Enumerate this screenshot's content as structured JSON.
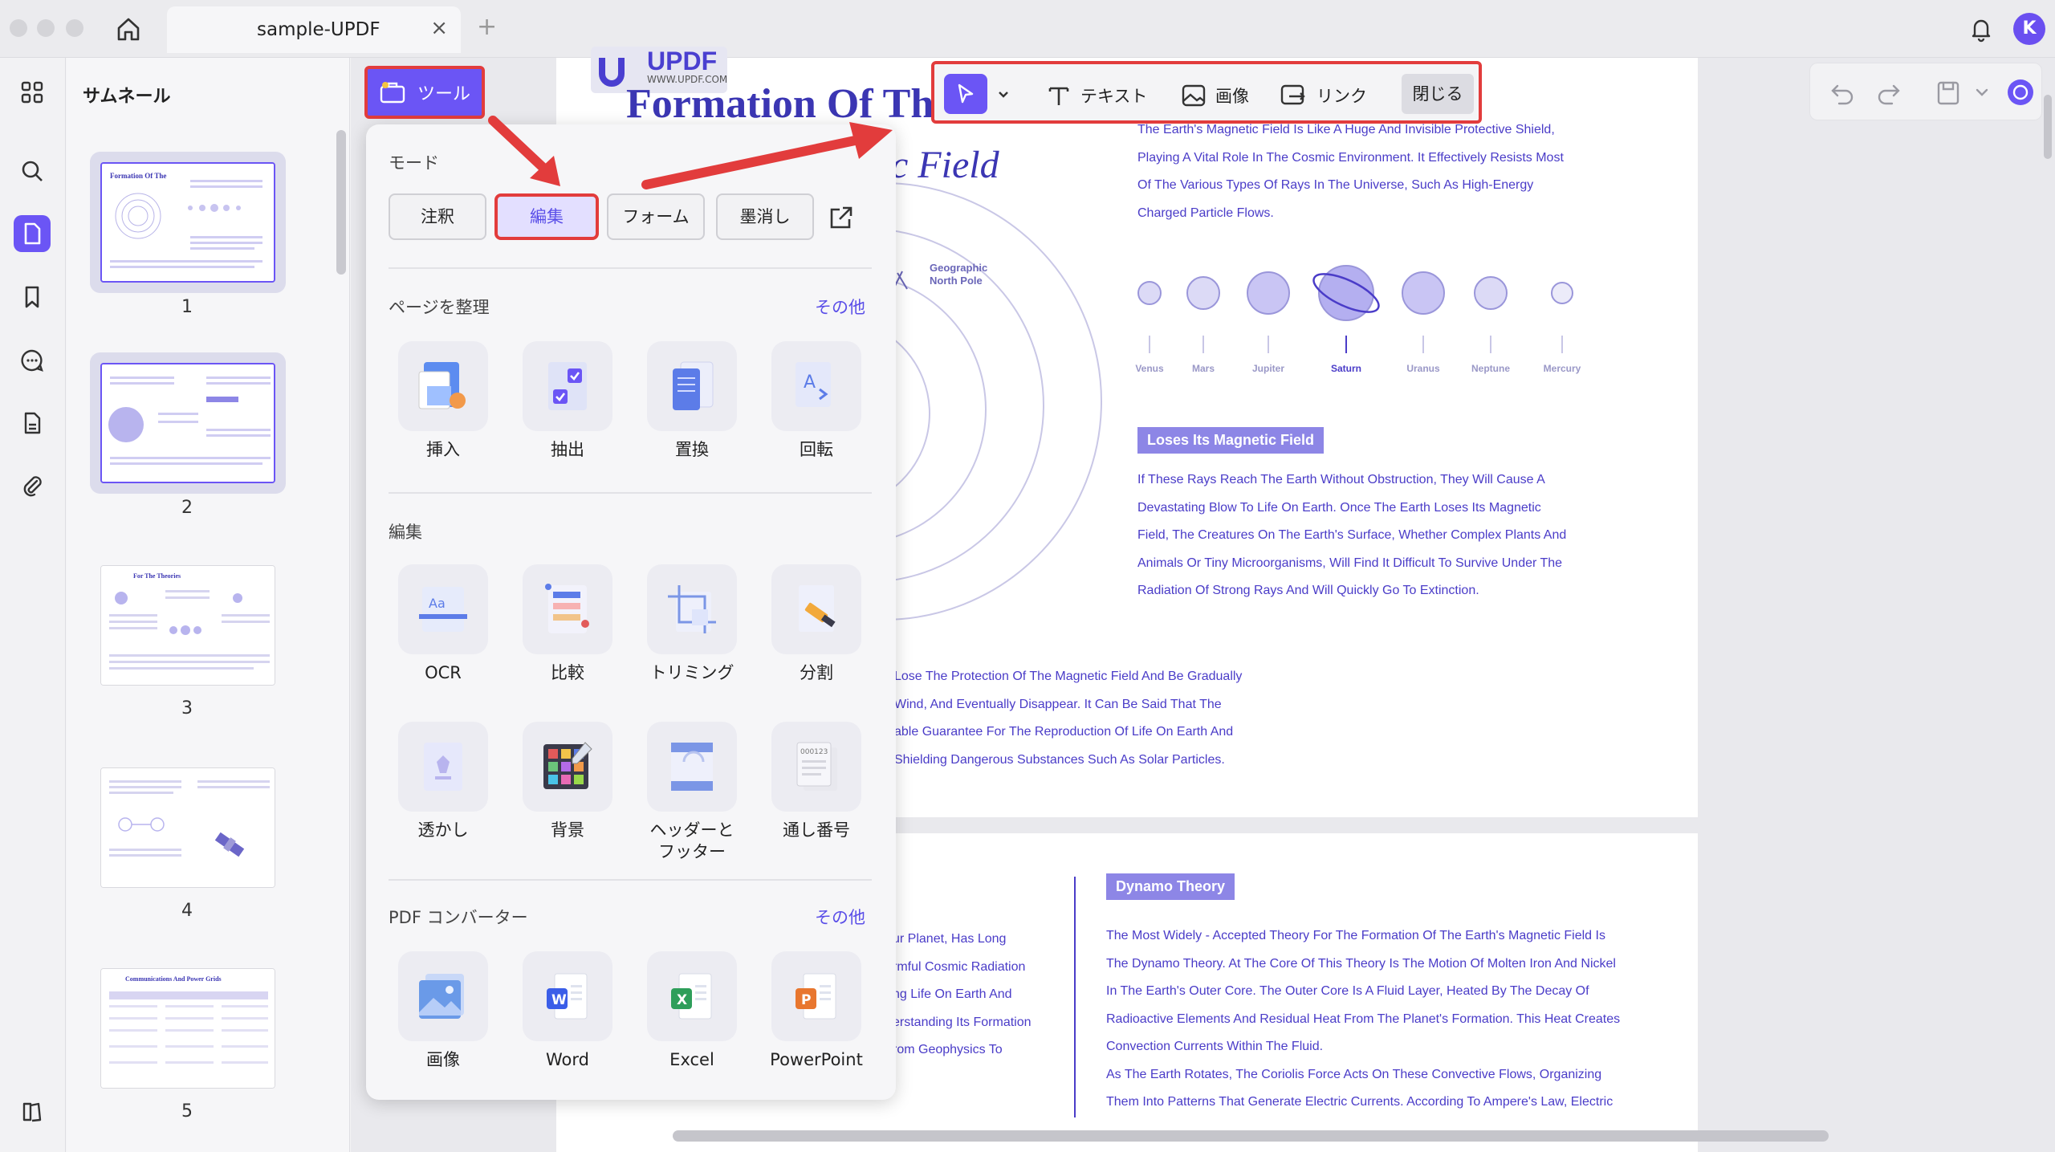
{
  "window": {
    "tab_title": "sample-UPDF",
    "tab_close": "×",
    "tab_add": "+",
    "avatar_initial": "K"
  },
  "thumbnails": {
    "title": "サムネール",
    "pages": [
      "1",
      "2",
      "3",
      "4",
      "5"
    ]
  },
  "tool_button": {
    "label": "ツール"
  },
  "edit_toolbar": {
    "text_label": "テキスト",
    "image_label": "画像",
    "link_label": "リンク",
    "close_label": "閉じる"
  },
  "tools_panel": {
    "mode_title": "モード",
    "modes": [
      "注釈",
      "編集",
      "フォーム",
      "墨消し"
    ],
    "organize_title": "ページを整理",
    "organize_more": "その他",
    "organize_items": [
      "挿入",
      "抽出",
      "置換",
      "回転"
    ],
    "edit_title": "編集",
    "edit_items_row1": [
      "OCR",
      "比較",
      "トリミング",
      "分割"
    ],
    "edit_items_row2": [
      "透かし",
      "背景",
      "ヘッダーと\nフッター",
      "通し番号"
    ],
    "converter_title": "PDF コンバーター",
    "converter_more": "その他",
    "converter_items": [
      "画像",
      "Word",
      "Excel",
      "PowerPoint"
    ]
  },
  "document": {
    "logo_text": "UPDF",
    "logo_url": "WWW.UPDF.COM",
    "title_line1": "Formation Of Th",
    "title_line2": "c Field",
    "intro_lines": [
      "The Earth's Magnetic Field Is Like A Huge And Invisible Protective Shield,",
      "Playing A Vital Role In The Cosmic Environment. It Effectively Resists Most",
      "Of The Various Types Of Rays In The Universe, Such As High-Energy",
      "Charged Particle Flows."
    ],
    "geo_label": "Geographic\nNorth Pole",
    "planets": [
      "Venus",
      "Mars",
      "Jupiter",
      "Saturn",
      "Uranus",
      "Neptune",
      "Mercury"
    ],
    "loses_title": "Loses Its Magnetic Field",
    "loses_lines": [
      "If These Rays Reach The Earth Without Obstruction, They Will Cause A",
      "Devastating Blow To Life On Earth. Once The Earth Loses Its Magnetic",
      "Field, The Creatures On The Earth's Surface, Whether Complex Plants And",
      "Animals Or Tiny Microorganisms, Will Find It Difficult To Survive Under The",
      "Radiation Of Strong Rays And Will Quickly Go To Extinction."
    ],
    "partial_lines": [
      "Lose The Protection Of The Magnetic Field And Be Gradually",
      "Wind, And Eventually Disappear. It Can Be Said That The",
      "able Guarantee For The Reproduction Of Life On Earth And",
      "Shielding Dangerous Substances Such As Solar Particles."
    ],
    "page2_left_lines": [
      "ur Planet, Has Long",
      "rmful Cosmic Radiation",
      "ng Life On Earth And",
      "erstanding Its Formation",
      "rom Geophysics To"
    ],
    "dynamo_title": "Dynamo Theory",
    "dynamo_lines": [
      "The Most Widely - Accepted Theory For The Formation Of The Earth's Magnetic Field Is",
      "The Dynamo Theory. At The Core Of This Theory Is The Motion Of Molten Iron And Nickel",
      "In The Earth's Outer Core. The Outer Core Is A Fluid Layer, Heated By The Decay Of",
      "Radioactive Elements And Residual Heat From The Planet's Formation. This Heat Creates",
      "Convection Currents Within The Fluid.",
      "As The Earth Rotates, The Coriolis Force Acts On These Convective Flows, Organizing",
      "Them Into Patterns That Generate Electric Currents. According To Ampere's Law, Electric"
    ]
  },
  "colors": {
    "accent": "#6b55f5",
    "highlight_red": "#e23c3c",
    "doc_text": "#4a3cc8"
  }
}
